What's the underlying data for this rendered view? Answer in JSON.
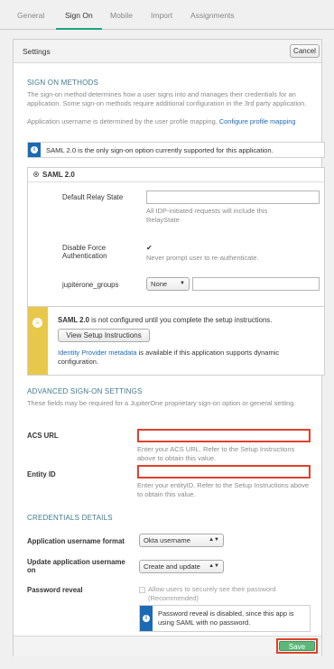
{
  "tabs": [
    "General",
    "Sign On",
    "Mobile",
    "Import",
    "Assignments"
  ],
  "active_tab": "Sign On",
  "settings": {
    "title": "Settings",
    "cancel_label": "Cancel",
    "save_label": "Save"
  },
  "sign_on_methods": {
    "heading": "SIGN ON METHODS",
    "desc1": "The sign-on method determines how a user signs into and manages their credentials for an application. Some sign-on methods require additional configuration in the 3rd party application.",
    "desc2": "Application username is determined by the user profile mapping.",
    "desc2_link": "Configure profile mapping",
    "info_notice": "SAML 2.0 is the only sign-on option currently supported for this application.",
    "option_label": "SAML 2.0",
    "fields": {
      "relay_state_label": "Default Relay State",
      "relay_state_value": "",
      "relay_state_help": "All IDP-initiated requests will include this RelayState",
      "disable_force_label": "Disable Force Authentication",
      "disable_force_checked": true,
      "disable_force_help": "Never prompt user to re-authenticate.",
      "groups_label": "jupiterone_groups",
      "groups_select": "None",
      "groups_value": ""
    },
    "setup_notice": {
      "bold": "SAML 2.0",
      "text": "is not configured until you complete the setup instructions.",
      "button_label": "View Setup Instructions",
      "metadata_link": "Identity Provider metadata",
      "metadata_text": "is available if this application supports dynamic configuration."
    }
  },
  "advanced": {
    "heading": "ADVANCED SIGN-ON SETTINGS",
    "desc": "These fields may be required for a JupiterOne proprietary sign-on option or general setting.",
    "acs_label": "ACS URL",
    "acs_value": "",
    "acs_help": "Enter your ACS URL. Refer to the Setup Instructions above to obtain this value.",
    "entity_label": "Entity ID",
    "entity_value": "",
    "entity_help": "Enter your entityID. Refer to the Setup Instructions above to obtain this value."
  },
  "credentials": {
    "heading": "CREDENTIALS DETAILS",
    "username_format_label": "Application username format",
    "username_format_value": "Okta username",
    "update_label": "Update application username on",
    "update_value": "Create and update",
    "password_reveal_label": "Password reveal",
    "password_reveal_checkbox": "Allow users to securely see their password (Recommended)",
    "password_reveal_notice": "Password reveal is disabled, since this app is using SAML with no password."
  },
  "colors": {
    "accent": "#1fa37f",
    "highlight": "#e0402a",
    "info": "#1b6ab5",
    "warning": "#e8c84a",
    "save": "#5cb87a"
  },
  "icons": {
    "info": "info-icon",
    "warning": "warning-icon",
    "checkbox": "checkbox-icon",
    "radio": "radio-icon"
  }
}
